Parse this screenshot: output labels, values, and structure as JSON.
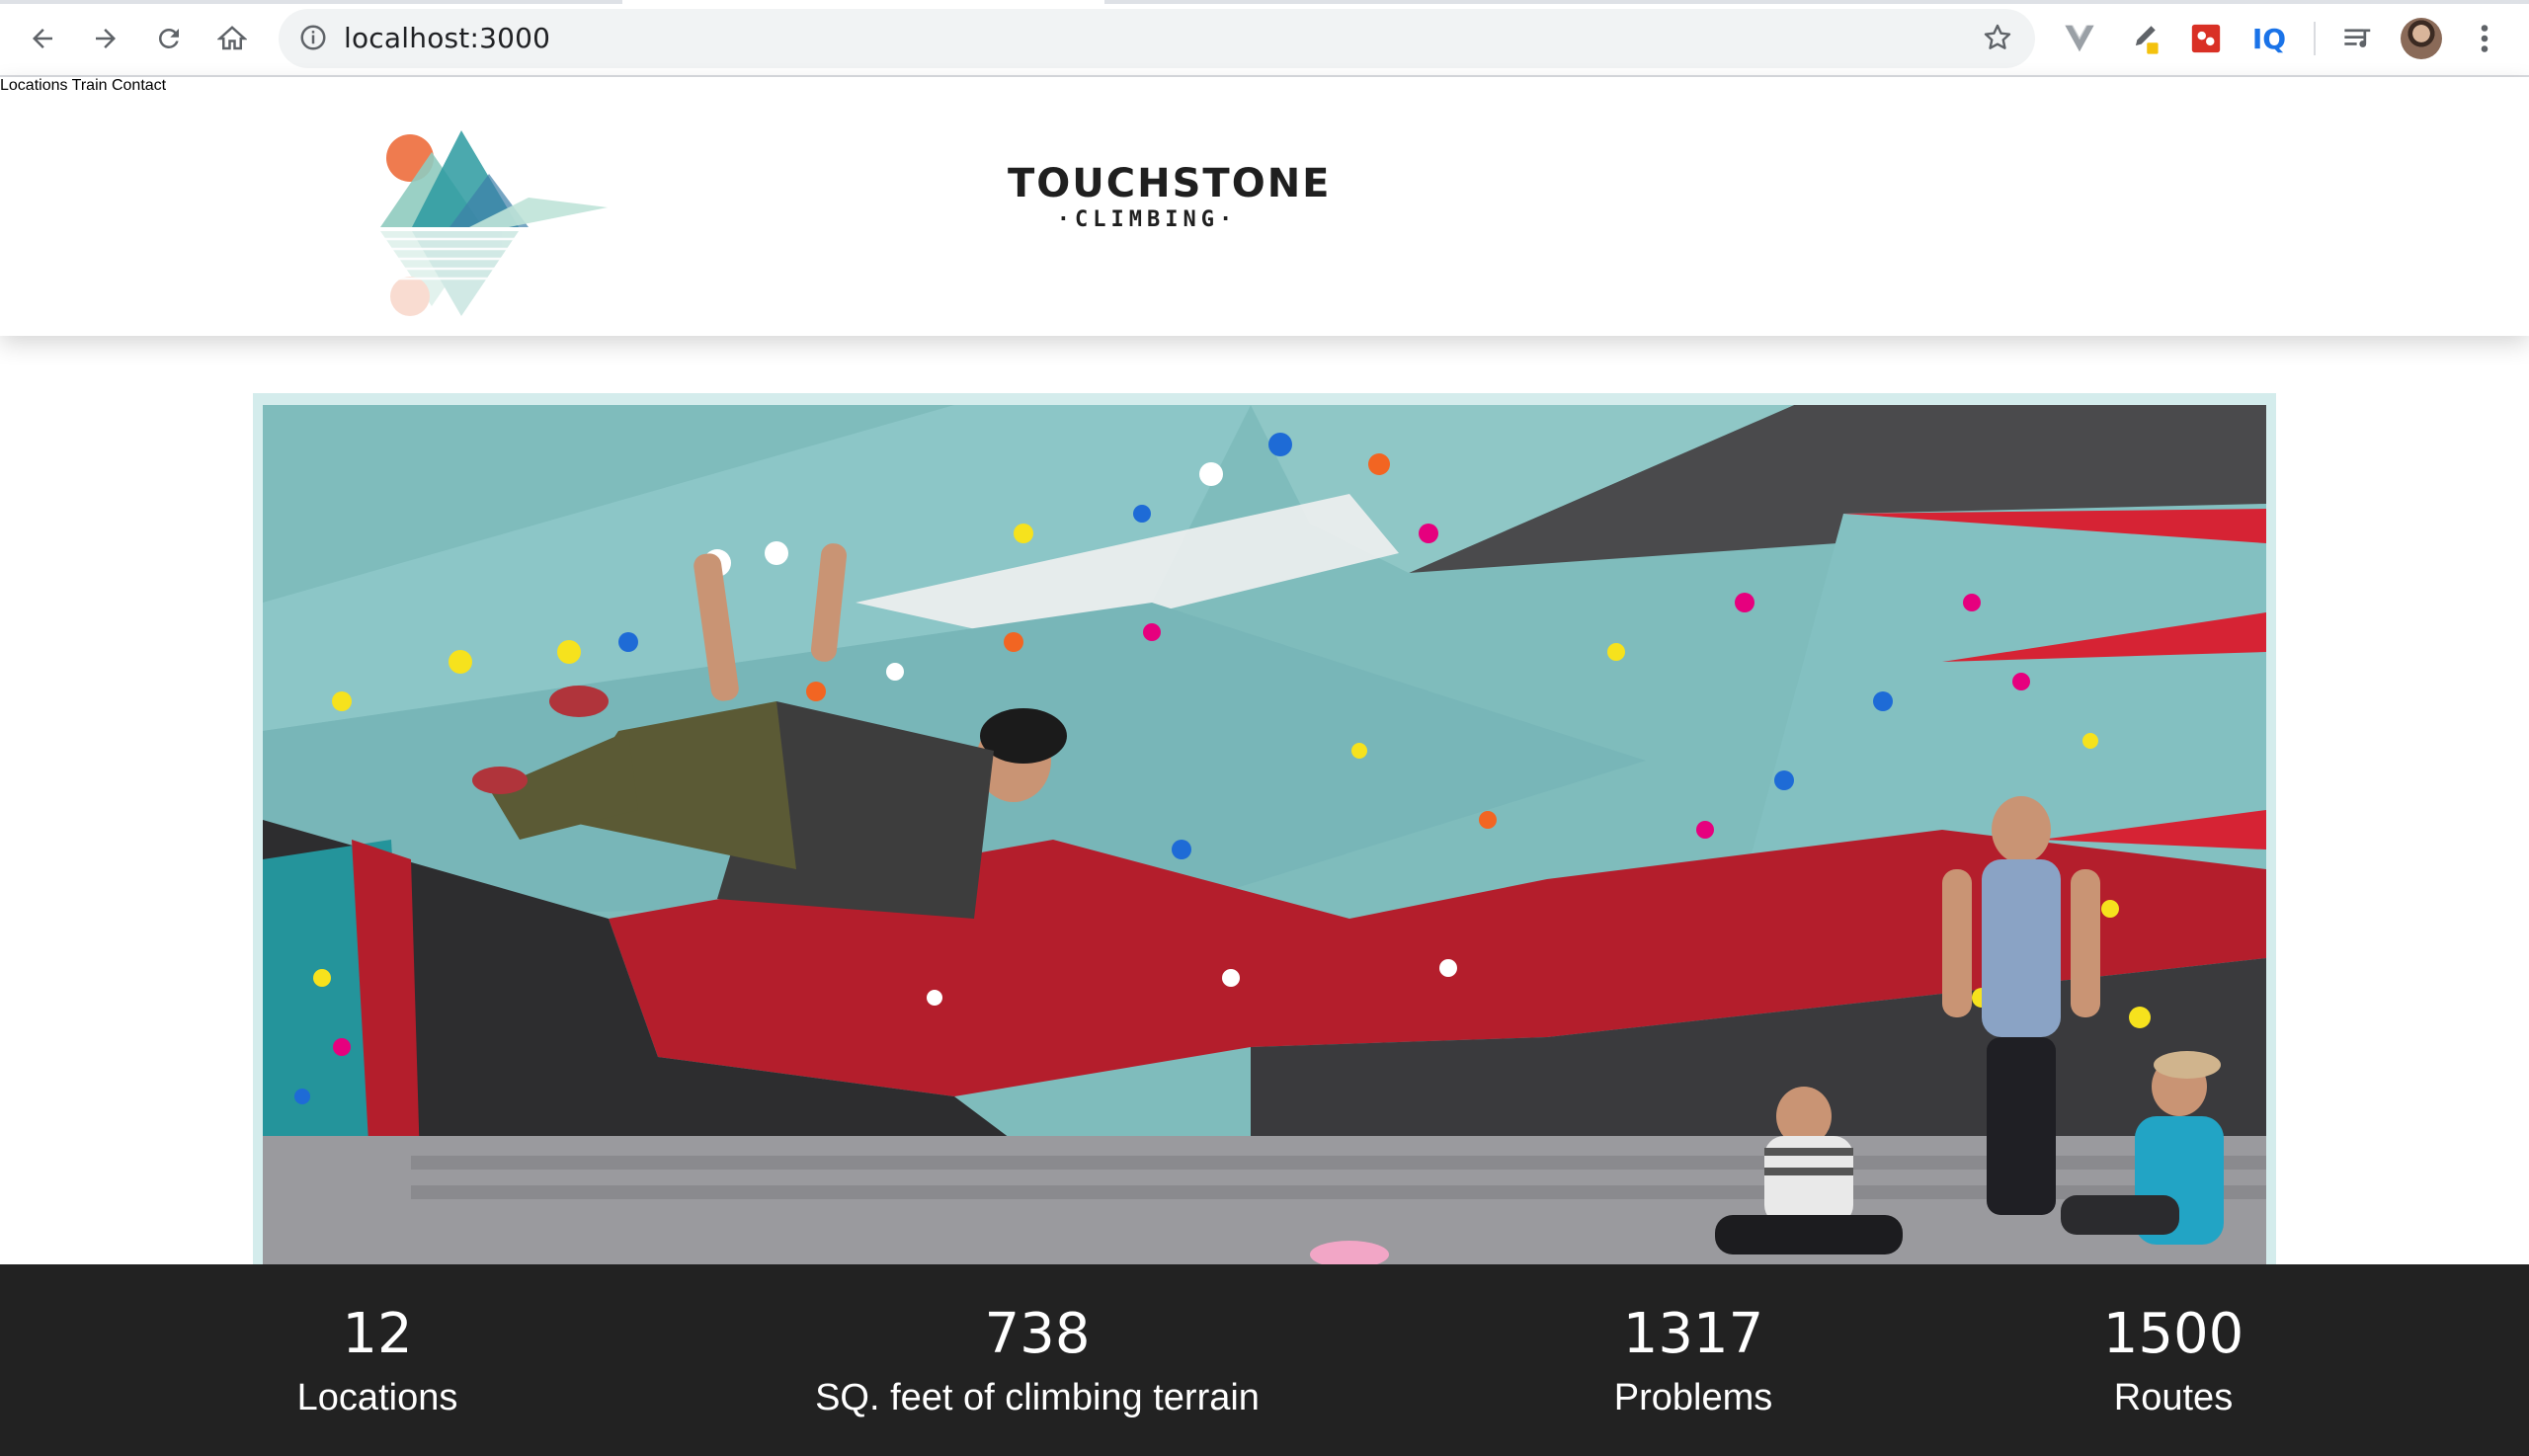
{
  "browser": {
    "url": "localhost:3000",
    "extensions": [
      "vue-devtools-icon",
      "color-picker-icon",
      "puzzle-extension-icon",
      "IQ",
      "reading-list-icon"
    ]
  },
  "site": {
    "brand": {
      "name": "TOUCHSTONE",
      "sub": "·CLIMBING·"
    },
    "nav": [
      "Locations",
      "Train",
      "Contact"
    ],
    "colors": {
      "accent": "#2aa39c",
      "stats_bg": "#222222",
      "frame": "#d4ecec"
    }
  },
  "stats": [
    {
      "value": "12",
      "label": "Locations"
    },
    {
      "value": "738",
      "label": "SQ. feet of climbing terrain"
    },
    {
      "value": "1317",
      "label": "Problems"
    },
    {
      "value": "1500",
      "label": "Routes"
    }
  ]
}
